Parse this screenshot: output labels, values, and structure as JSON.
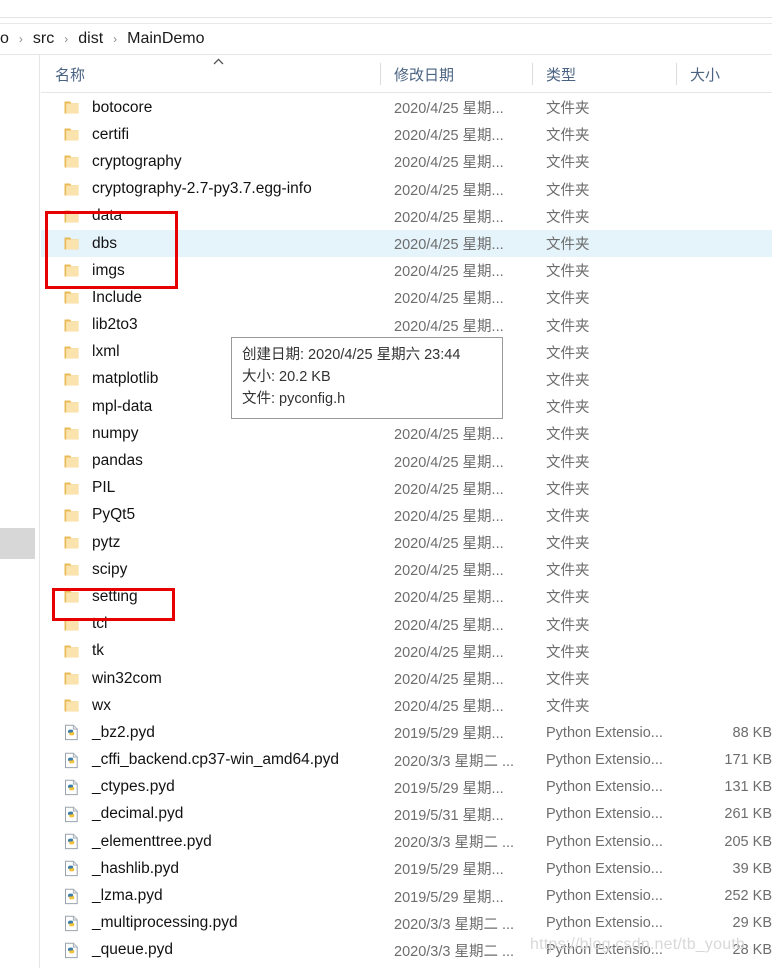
{
  "breadcrumb": {
    "separator": "›",
    "items": [
      "o",
      "src",
      "dist",
      "MainDemo"
    ]
  },
  "columns": {
    "name": "名称",
    "date_modified": "修改日期",
    "type": "类型",
    "size": "大小",
    "sort_indicator": "ascending-chevron"
  },
  "tooltip": {
    "created_label": "创建日期: 2020/4/25 星期六 23:44",
    "size_label": "大小: 20.2 KB",
    "file_label": "文件: pyconfig.h"
  },
  "watermark": "https://blog.csdn.net/tb_youtb",
  "colors": {
    "selection": "#e5f3fb",
    "annotation": "#e60000",
    "folder": "#f5d083",
    "header_text": "#4a6382"
  },
  "files": [
    {
      "name": "botocore",
      "date": "2020/4/25 星期...",
      "type": "文件夹",
      "size": "",
      "icon": "folder-icon",
      "selected": false
    },
    {
      "name": "certifi",
      "date": "2020/4/25 星期...",
      "type": "文件夹",
      "size": "",
      "icon": "folder-icon",
      "selected": false
    },
    {
      "name": "cryptography",
      "date": "2020/4/25 星期...",
      "type": "文件夹",
      "size": "",
      "icon": "folder-icon",
      "selected": false
    },
    {
      "name": "cryptography-2.7-py3.7.egg-info",
      "date": "2020/4/25 星期...",
      "type": "文件夹",
      "size": "",
      "icon": "folder-icon",
      "selected": false
    },
    {
      "name": "data",
      "date": "2020/4/25 星期...",
      "type": "文件夹",
      "size": "",
      "icon": "folder-icon",
      "selected": false
    },
    {
      "name": "dbs",
      "date": "2020/4/25 星期...",
      "type": "文件夹",
      "size": "",
      "icon": "folder-icon",
      "selected": true
    },
    {
      "name": "imgs",
      "date": "2020/4/25 星期...",
      "type": "文件夹",
      "size": "",
      "icon": "folder-icon",
      "selected": false
    },
    {
      "name": "Include",
      "date": "2020/4/25 星期...",
      "type": "文件夹",
      "size": "",
      "icon": "folder-icon",
      "selected": false
    },
    {
      "name": "lib2to3",
      "date": "2020/4/25 星期...",
      "type": "文件夹",
      "size": "",
      "icon": "folder-icon",
      "selected": false
    },
    {
      "name": "lxml",
      "date": "2020/4/25 星期...",
      "type": "文件夹",
      "size": "",
      "icon": "folder-icon",
      "selected": false
    },
    {
      "name": "matplotlib",
      "date": "2020/4/25 星期...",
      "type": "文件夹",
      "size": "",
      "icon": "folder-icon",
      "selected": false
    },
    {
      "name": "mpl-data",
      "date": "2020/4/25 星期...",
      "type": "文件夹",
      "size": "",
      "icon": "folder-icon",
      "selected": false
    },
    {
      "name": "numpy",
      "date": "2020/4/25 星期...",
      "type": "文件夹",
      "size": "",
      "icon": "folder-icon",
      "selected": false
    },
    {
      "name": "pandas",
      "date": "2020/4/25 星期...",
      "type": "文件夹",
      "size": "",
      "icon": "folder-icon",
      "selected": false
    },
    {
      "name": "PIL",
      "date": "2020/4/25 星期...",
      "type": "文件夹",
      "size": "",
      "icon": "folder-icon",
      "selected": false
    },
    {
      "name": "PyQt5",
      "date": "2020/4/25 星期...",
      "type": "文件夹",
      "size": "",
      "icon": "folder-icon",
      "selected": false
    },
    {
      "name": "pytz",
      "date": "2020/4/25 星期...",
      "type": "文件夹",
      "size": "",
      "icon": "folder-icon",
      "selected": false
    },
    {
      "name": "scipy",
      "date": "2020/4/25 星期...",
      "type": "文件夹",
      "size": "",
      "icon": "folder-icon",
      "selected": false
    },
    {
      "name": "setting",
      "date": "2020/4/25 星期...",
      "type": "文件夹",
      "size": "",
      "icon": "folder-icon",
      "selected": false
    },
    {
      "name": "tcl",
      "date": "2020/4/25 星期...",
      "type": "文件夹",
      "size": "",
      "icon": "folder-icon",
      "selected": false
    },
    {
      "name": "tk",
      "date": "2020/4/25 星期...",
      "type": "文件夹",
      "size": "",
      "icon": "folder-icon",
      "selected": false
    },
    {
      "name": "win32com",
      "date": "2020/4/25 星期...",
      "type": "文件夹",
      "size": "",
      "icon": "folder-icon",
      "selected": false
    },
    {
      "name": "wx",
      "date": "2020/4/25 星期...",
      "type": "文件夹",
      "size": "",
      "icon": "folder-icon",
      "selected": false
    },
    {
      "name": "_bz2.pyd",
      "date": "2019/5/29 星期...",
      "type": "Python Extensio...",
      "size": "88 KB",
      "icon": "python-file-icon",
      "selected": false
    },
    {
      "name": "_cffi_backend.cp37-win_amd64.pyd",
      "date": "2020/3/3 星期二 ...",
      "type": "Python Extensio...",
      "size": "171 KB",
      "icon": "python-file-icon",
      "selected": false
    },
    {
      "name": "_ctypes.pyd",
      "date": "2019/5/29 星期...",
      "type": "Python Extensio...",
      "size": "131 KB",
      "icon": "python-file-icon",
      "selected": false
    },
    {
      "name": "_decimal.pyd",
      "date": "2019/5/31 星期...",
      "type": "Python Extensio...",
      "size": "261 KB",
      "icon": "python-file-icon",
      "selected": false
    },
    {
      "name": "_elementtree.pyd",
      "date": "2020/3/3 星期二 ...",
      "type": "Python Extensio...",
      "size": "205 KB",
      "icon": "python-file-icon",
      "selected": false
    },
    {
      "name": "_hashlib.pyd",
      "date": "2019/5/29 星期...",
      "type": "Python Extensio...",
      "size": "39 KB",
      "icon": "python-file-icon",
      "selected": false
    },
    {
      "name": "_lzma.pyd",
      "date": "2019/5/29 星期...",
      "type": "Python Extensio...",
      "size": "252 KB",
      "icon": "python-file-icon",
      "selected": false
    },
    {
      "name": "_multiprocessing.pyd",
      "date": "2020/3/3 星期二 ...",
      "type": "Python Extensio...",
      "size": "29 KB",
      "icon": "python-file-icon",
      "selected": false
    },
    {
      "name": "_queue.pyd",
      "date": "2020/3/3 星期二 ...",
      "type": "Python Extensio...",
      "size": "28 KB",
      "icon": "python-file-icon",
      "selected": false
    }
  ]
}
